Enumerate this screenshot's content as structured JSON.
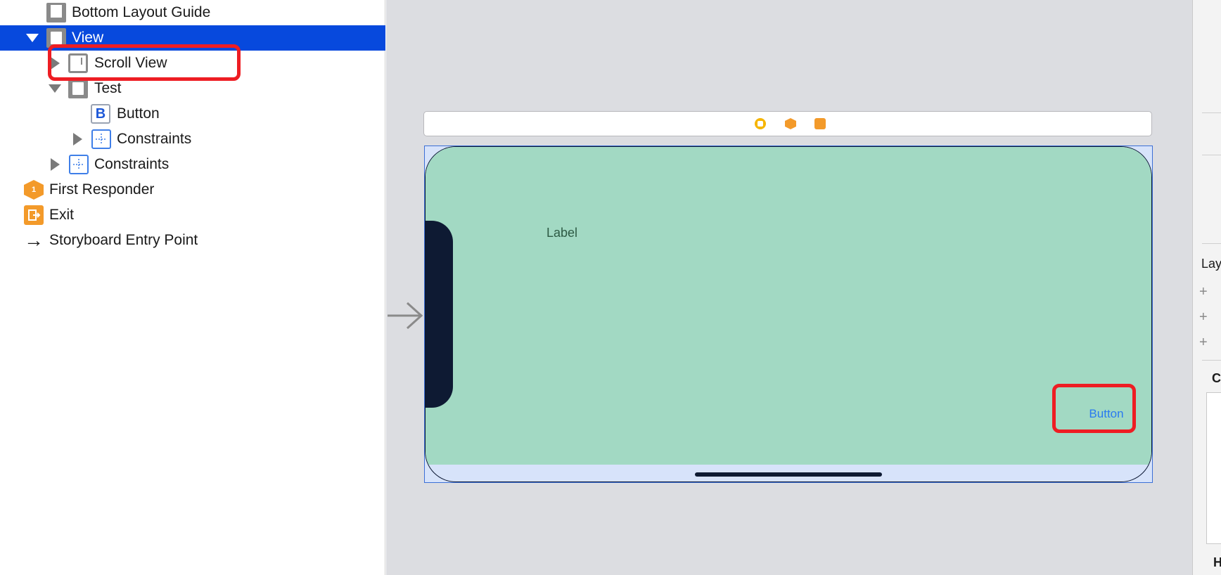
{
  "outline": {
    "items": [
      {
        "label": "Bottom Layout Guide",
        "icon": "layout-guide-icon"
      },
      {
        "label": "View",
        "icon": "view-icon"
      },
      {
        "label": "Scroll View",
        "icon": "scroll-view-icon"
      },
      {
        "label": "Test",
        "icon": "view-icon"
      },
      {
        "label": "Button",
        "icon": "button-icon",
        "glyph": "B"
      },
      {
        "label": "Constraints",
        "icon": "constraints-icon"
      },
      {
        "label": "Constraints",
        "icon": "constraints-icon"
      },
      {
        "label": "First Responder",
        "icon": "first-responder-icon",
        "glyph": "1"
      },
      {
        "label": "Exit",
        "icon": "exit-icon"
      },
      {
        "label": "Storyboard Entry Point",
        "icon": "arrow-right-icon",
        "glyph": "→"
      }
    ]
  },
  "canvas": {
    "scene_label": "Label",
    "scene_button": "Button"
  },
  "inspector": {
    "section_layout": "Lay",
    "section_c": "C",
    "section_h": "H",
    "plus_glyph": "+"
  },
  "colors": {
    "selection": "#0749dd",
    "annotation": "#ee1d23",
    "scene_background": "#a2d9c3",
    "button_text": "#2a7af0"
  }
}
